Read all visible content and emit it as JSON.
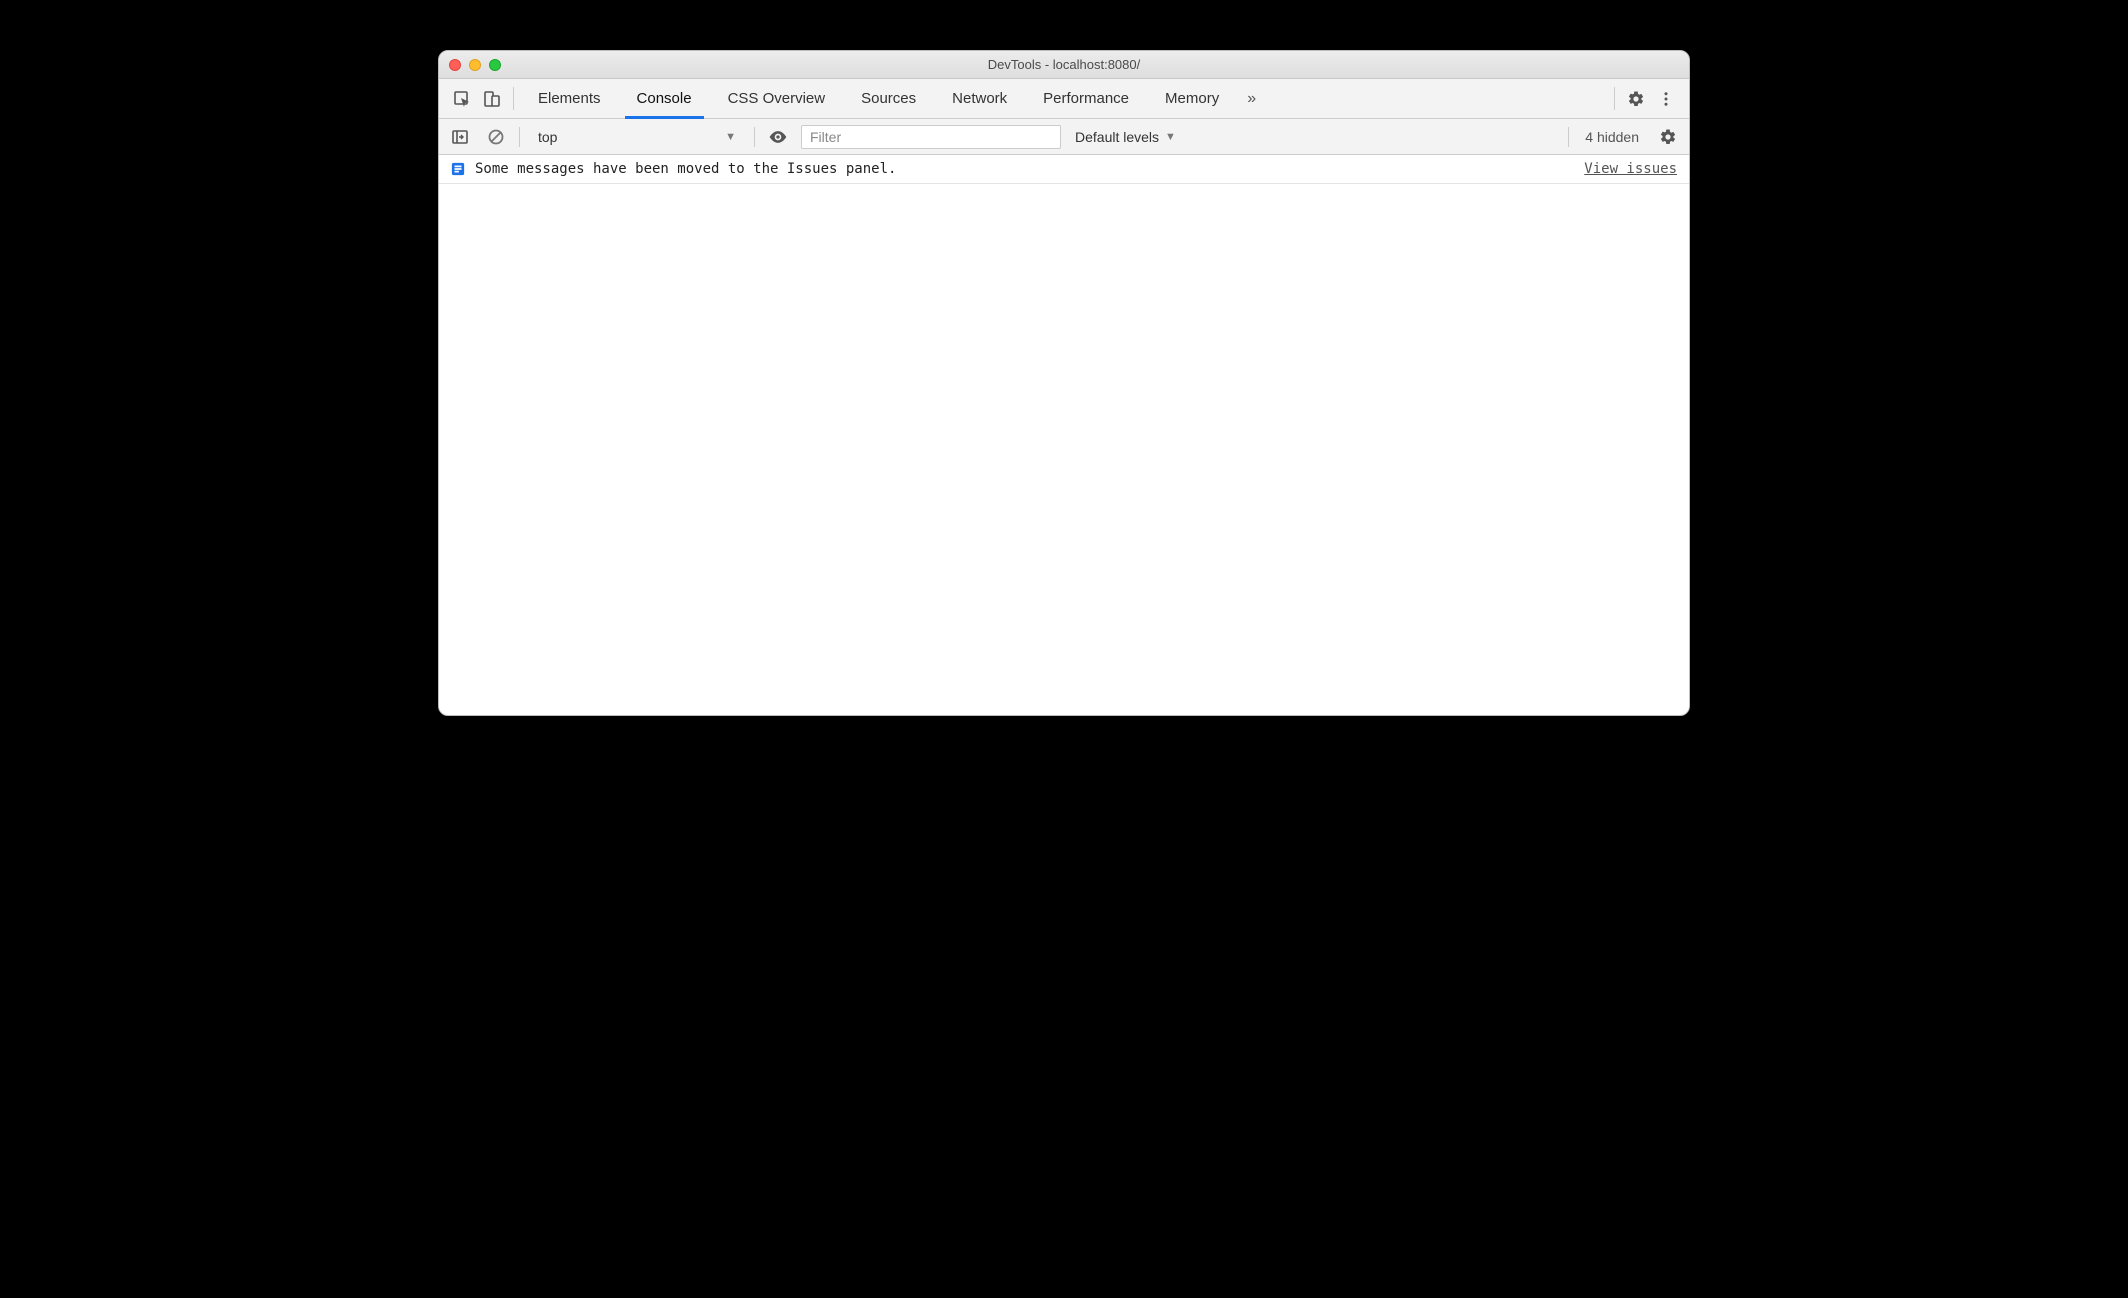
{
  "window": {
    "title": "DevTools - localhost:8080/"
  },
  "tabs": {
    "items": [
      "Elements",
      "Console",
      "CSS Overview",
      "Sources",
      "Network",
      "Performance",
      "Memory"
    ],
    "active": "Console"
  },
  "console_toolbar": {
    "context": "top",
    "filter_placeholder": "Filter",
    "levels_label": "Default levels",
    "hidden_label": "4 hidden"
  },
  "message": {
    "text": "Some messages have been moved to the Issues panel.",
    "link": "View issues"
  }
}
